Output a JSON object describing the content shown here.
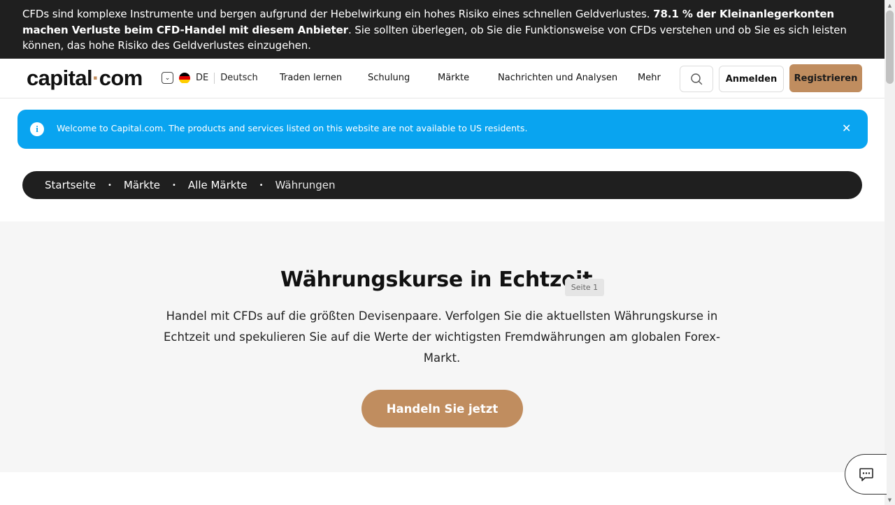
{
  "risk_banner": {
    "text_before": "CFDs sind komplexe Instrumente und bergen aufgrund der Hebelwirkung ein hohes Risiko eines schnellen Geldverlustes. ",
    "text_bold": "78.1 % der Kleinanlegerkonten machen Verluste beim CFD-Handel mit diesem Anbieter",
    "text_after": ". Sie sollten überlegen, ob Sie die Funktionsweise von CFDs verstehen und ob Sie es sich leisten können, das hohe Risiko des Geldverlustes einzugehen."
  },
  "header": {
    "logo_left": "capital",
    "logo_dot": "·",
    "logo_right": "com",
    "lang_code": "DE",
    "lang_name": "Deutsch",
    "nav": [
      "Traden lernen",
      "Schulung",
      "Märkte",
      "Nachrichten und Analysen",
      "Mehr"
    ],
    "login": "Anmelden",
    "register": "Registrieren"
  },
  "info_bar": {
    "message": "Welcome to Capital.com. The products and services listed on this website are not available to US residents.",
    "icon": "info-icon",
    "close_icon": "close-icon"
  },
  "breadcrumb": [
    "Startseite",
    "Märkte",
    "Alle Märkte",
    "Währungen"
  ],
  "hero": {
    "title": "Währungskurse in Echtzeit",
    "page_badge": "Seite 1",
    "description": "Handel mit CFDs auf die größten Devisenpaare. Verfolgen Sie die aktuellsten Währungskurse in Echtzeit und spekulieren Sie auf die Werte der wichtigsten Fremdwährungen am globalen Forex-Markt.",
    "cta": "Handeln Sie jetzt"
  },
  "colors": {
    "accent": "#c08d5f",
    "info": "#09a4f0",
    "dark": "#1f1f1f"
  }
}
